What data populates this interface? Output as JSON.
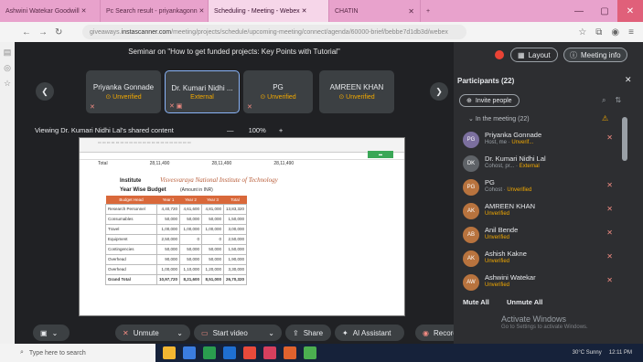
{
  "browser": {
    "tabs": [
      {
        "label": "Ashwini Watekar Goodwill ✕",
        "active": false
      },
      {
        "label": "Pc Search result - priyankagonn ✕",
        "active": false
      },
      {
        "label": "Scheduling - Meeting - Webex ✕",
        "active": true
      },
      {
        "label": "CHATIN",
        "active": false
      }
    ],
    "url_prefix": "giveaways.",
    "url_domain": "instascanner.com",
    "url_rest": "/meeting/projects/schedule/upcoming-meeting/connect/agenda/60000-brief/bebbe7d1db3d/webex",
    "window_controls": [
      "—",
      "▢",
      "✕"
    ]
  },
  "meeting": {
    "title": "Seminar on \"How to get funded projects: Key Points with Tutorial\"",
    "tiles": [
      {
        "name": "Priyanka Gonnade",
        "status": "Unverified"
      },
      {
        "name": "Dr. Kumari Nidhi ...",
        "status": "External"
      },
      {
        "name": "PG",
        "status": "Unverified"
      },
      {
        "name": "AMREEN KHAN",
        "status": "Unverified"
      }
    ],
    "viewing_text": "Viewing Dr. Kumari Nidhi Lal's shared content",
    "zoom_level": "100%",
    "zoom_minus": "—",
    "zoom_plus": "+"
  },
  "sheet": {
    "top_row": [
      "Total",
      "28,11,490",
      "28,11,490",
      "28,11,490"
    ],
    "institute_label": "Institute",
    "institute_name": "Visvesvaraya National Institute of Technology",
    "year_label": "Year Wise Budget",
    "year_sub": "(Amount in INR)",
    "columns": [
      "Budget Head",
      "Year 1",
      "Year 2",
      "Year 3",
      "Total"
    ],
    "rows": [
      [
        "Research Personnel",
        "4,40,720",
        "4,61,600",
        "4,81,000",
        "13,83,320"
      ],
      [
        "Consumables",
        "50,000",
        "50,000",
        "50,000",
        "1,50,000"
      ],
      [
        "Travel",
        "1,00,000",
        "1,00,000",
        "1,00,000",
        "3,00,000"
      ],
      [
        "Equipment",
        "2,50,000",
        "0",
        "0",
        "2,50,000"
      ],
      [
        "Contingencies",
        "50,000",
        "50,000",
        "50,000",
        "1,50,000"
      ],
      [
        "Overhead",
        "90,000",
        "50,000",
        "50,000",
        "1,90,000"
      ],
      [
        "Overhead",
        "1,00,000",
        "1,10,000",
        "1,20,000",
        "3,30,000"
      ],
      [
        "Grand Total",
        "10,97,720",
        "8,21,600",
        "8,51,000",
        "26,70,320"
      ]
    ]
  },
  "controls": {
    "unmute": "Unmute",
    "start_video": "Start video",
    "share": "Share",
    "ai_assistant": "AI Assistant",
    "record": "Record"
  },
  "panel": {
    "layout": "Layout",
    "meeting_info": "Meeting info",
    "title": "Participants (22)",
    "invite": "Invite people",
    "in_meeting": "In the meeting (22)",
    "participants": [
      {
        "initials": "PG",
        "name": "Priyanka Gonnade",
        "role": "Host, me · ",
        "status": "Unverif...",
        "photo": false
      },
      {
        "initials": "DK",
        "name": "Dr. Kumari Nidhi Lal",
        "role": "Cohost, pr... · ",
        "status": "External",
        "photo": false
      },
      {
        "initials": "PG",
        "name": "PG",
        "role": "Cohost · ",
        "status": "Unverified",
        "photo": true
      },
      {
        "initials": "AK",
        "name": "AMREEN KHAN",
        "role": "",
        "status": "Unverified",
        "photo": true
      },
      {
        "initials": "AB",
        "name": "Anil Bende",
        "role": "",
        "status": "Unverified",
        "photo": true
      },
      {
        "initials": "AK",
        "name": "Ashish Kakne",
        "role": "",
        "status": "Unverified",
        "photo": true
      },
      {
        "initials": "AW",
        "name": "Ashwini Watekar",
        "role": "",
        "status": "Unverified",
        "photo": true
      }
    ],
    "mute_all": "Mute All",
    "unmute_all": "Unmute All",
    "activate_title": "Activate Windows",
    "activate_sub": "Go to Settings to activate Windows."
  },
  "taskbar": {
    "search_placeholder": "Type here to search",
    "tray_temp": "30°C Sunny",
    "tray_time": "12:11 PM"
  },
  "colors": {
    "accent_orange": "#f2a900",
    "hangup_red": "#ea4335",
    "table_header": "#d9683a",
    "tab_pink": "#e8a2cc"
  }
}
